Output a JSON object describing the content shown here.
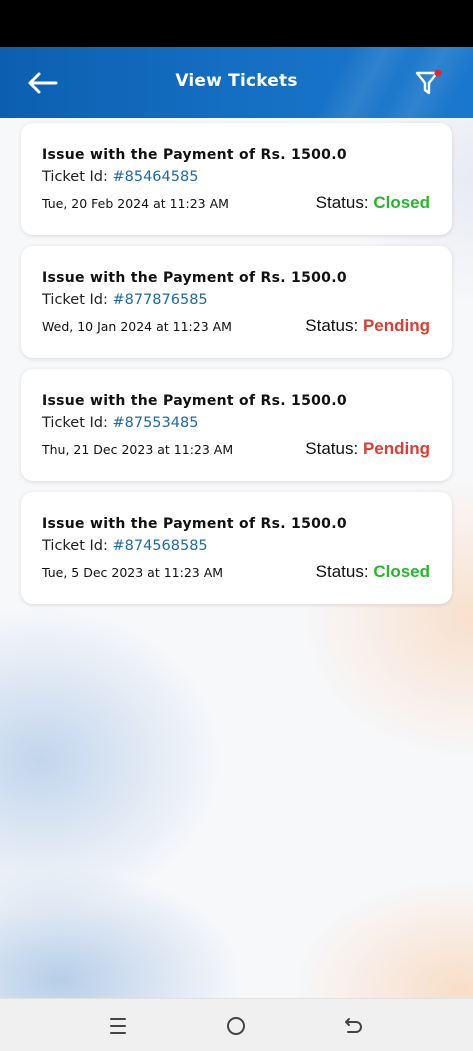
{
  "header": {
    "title": "View Tickets",
    "icons": {
      "back": "arrow-left-icon",
      "filter": "filter-icon"
    },
    "colors": {
      "bar": "#1570c4",
      "filter_dot": "#e0262b"
    }
  },
  "tickets": [
    {
      "title": "Issue with the Payment of Rs. 1500.0",
      "id_label": "Ticket Id:",
      "id": "#85464585",
      "date": "Tue, 20 Feb 2024 at 11:23 AM",
      "status_label": "Status:",
      "status": "Closed"
    },
    {
      "title": "Issue with the Payment of Rs. 1500.0",
      "id_label": "Ticket Id:",
      "id": "#877876585",
      "date": "Wed, 10 Jan 2024 at 11:23 AM",
      "status_label": "Status:",
      "status": "Pending"
    },
    {
      "title": "Issue with the Payment of Rs. 1500.0",
      "id_label": "Ticket Id:",
      "id": "#87553485",
      "date": "Thu, 21 Dec 2023 at 11:23 AM",
      "status_label": "Status:",
      "status": "Pending"
    },
    {
      "title": "Issue with the Payment of Rs. 1500.0",
      "id_label": "Ticket Id:",
      "id": "#874568585",
      "date": "Tue, 5 Dec 2023 at 11:23 AM",
      "status_label": "Status:",
      "status": "Closed"
    }
  ],
  "status_colors": {
    "Closed": "#25b82c",
    "Pending": "#e23b30"
  },
  "nav": {
    "icons": [
      "recent-apps-icon",
      "home-icon",
      "back-icon"
    ]
  }
}
